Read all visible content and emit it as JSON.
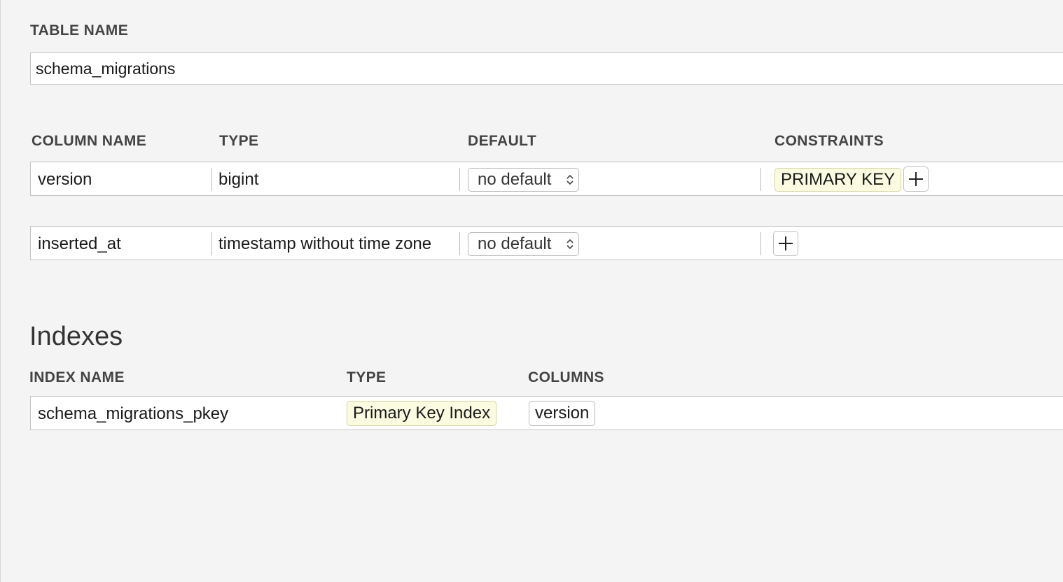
{
  "table": {
    "label": "TABLE NAME",
    "name": "schema_migrations"
  },
  "columns": {
    "headers": {
      "name": "COLUMN NAME",
      "type": "TYPE",
      "default": "DEFAULT",
      "constraints": "CONSTRAINTS"
    },
    "rows": [
      {
        "name": "version",
        "type": "bigint",
        "default": "no default",
        "constraints": [
          "PRIMARY KEY"
        ]
      },
      {
        "name": "inserted_at",
        "type": "timestamp without time zone",
        "default": "no default",
        "constraints": []
      }
    ]
  },
  "indexes": {
    "heading": "Indexes",
    "headers": {
      "name": "INDEX NAME",
      "type": "TYPE",
      "columns": "COLUMNS"
    },
    "rows": [
      {
        "name": "schema_migrations_pkey",
        "type": "Primary Key Index",
        "columns": [
          "version"
        ]
      }
    ]
  },
  "icons": {
    "add": "plus-icon",
    "select": "up-down-chevron-icon"
  },
  "colors": {
    "background": "#f4f4f4",
    "field": "#ffffff",
    "border": "#c4c4c4",
    "tag_background": "#fbfbe1",
    "tag_border": "#d6d69a",
    "label": "#444444"
  }
}
